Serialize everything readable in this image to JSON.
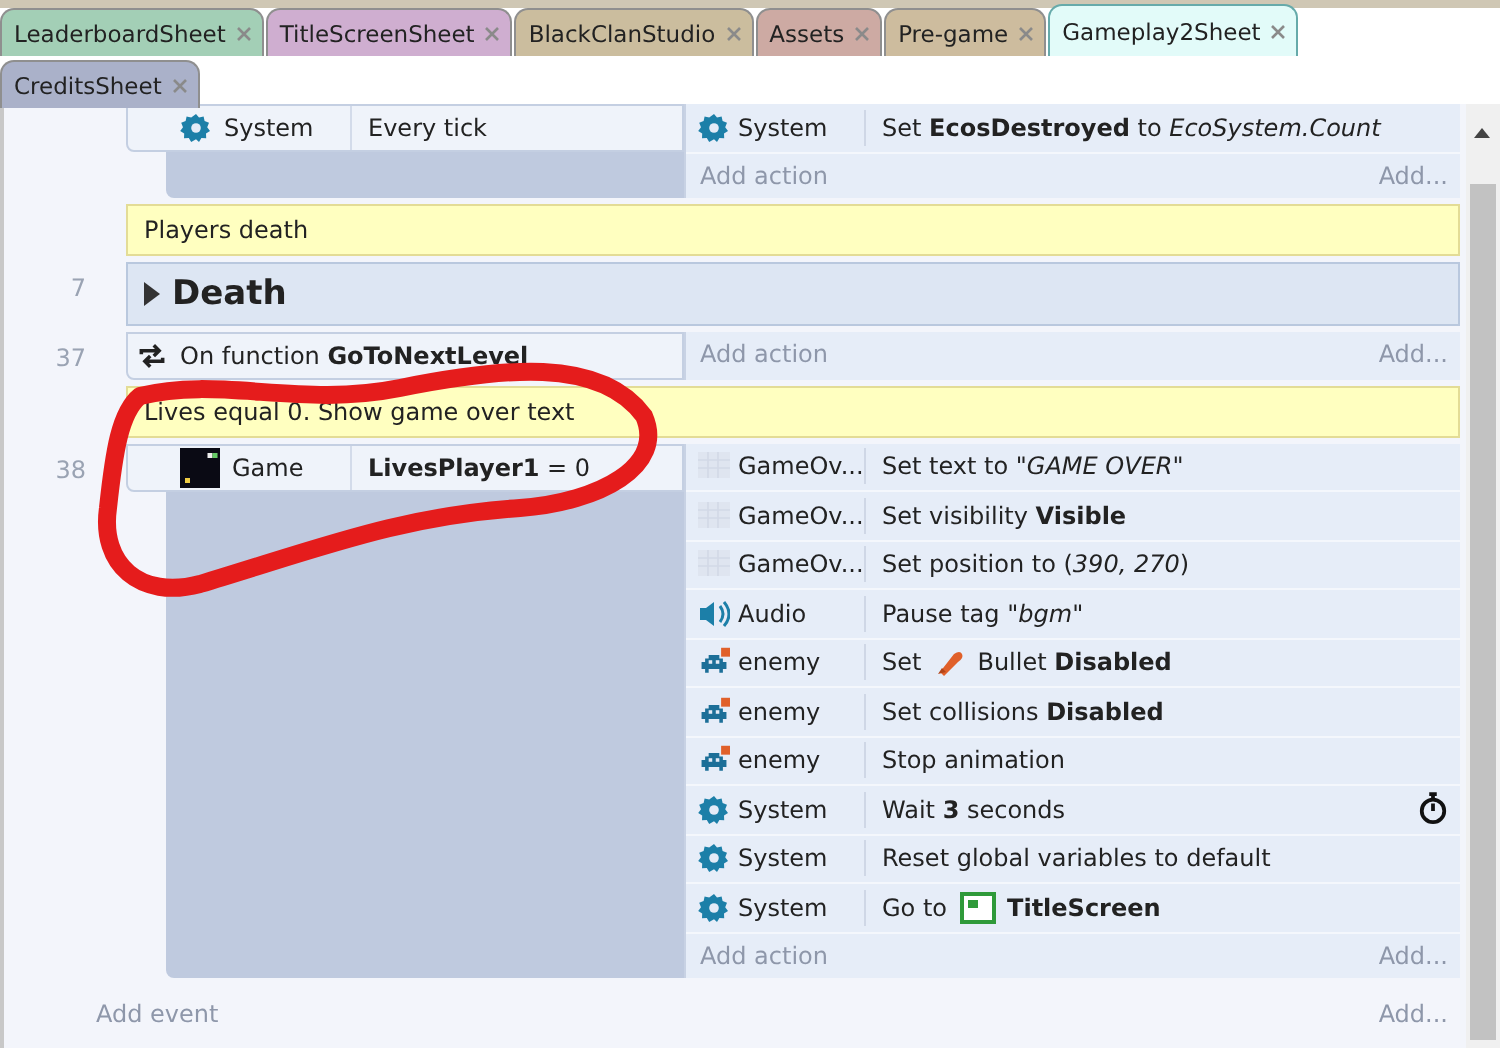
{
  "tabs": [
    {
      "label": "LeaderboardSheet",
      "color": "#a3cfb6",
      "selected": false
    },
    {
      "label": "TitleScreenSheet",
      "color": "#cfaed0",
      "selected": false
    },
    {
      "label": "BlackClanStudio",
      "color": "#cbbd9e",
      "selected": false
    },
    {
      "label": "Assets",
      "color": "#cdaaa3",
      "selected": false
    },
    {
      "label": "Pre-game",
      "color": "#cdbc9e",
      "selected": false
    },
    {
      "label": "Gameplay2Sheet",
      "color": "#e2fbf9",
      "selected": true
    },
    {
      "label": "CreditsSheet",
      "color": "#aab1c9",
      "selected": false
    }
  ],
  "sheet": [
    {
      "kind": "event",
      "conditions": [
        {
          "kind": "system",
          "object": "System",
          "text": "Every tick"
        }
      ],
      "actions": [
        {
          "kind": "system",
          "object": "System",
          "text": "Set **EcosDestroyed** to *EcoSystem.Count*"
        }
      ],
      "add_action": "Add action",
      "add": "Add..."
    },
    {
      "kind": "comment",
      "text": "Players death"
    },
    {
      "kind": "group",
      "line": "7",
      "title": "Death"
    },
    {
      "kind": "event",
      "line": "37",
      "conditions": [
        {
          "kind": "function",
          "text": "On function **GoToNextLevel**"
        }
      ],
      "add_action": "Add action",
      "add": "Add..."
    },
    {
      "kind": "comment",
      "text": "Lives equal 0. Show game over text"
    },
    {
      "kind": "event",
      "line": "38",
      "conditions": [
        {
          "kind": "game",
          "object": "Game",
          "text": "**LivesPlayer1** = 0"
        }
      ],
      "actions": [
        {
          "kind": "text",
          "object": "GameOv...",
          "text": "Set text to \"*GAME OVER*\""
        },
        {
          "kind": "text",
          "object": "GameOv...",
          "text": "Set visibility **Visible**"
        },
        {
          "kind": "text",
          "object": "GameOv...",
          "text": "Set position to (*390, 270*)"
        },
        {
          "kind": "audio",
          "object": "Audio",
          "text": "Pause tag \"*bgm*\""
        },
        {
          "kind": "enemy",
          "object": "enemy",
          "pre": "Set",
          "text": "Bullet **Disabled**"
        },
        {
          "kind": "enemy",
          "object": "enemy",
          "text": "Set collisions **Disabled**"
        },
        {
          "kind": "enemy",
          "object": "enemy",
          "text": "Stop animation"
        },
        {
          "kind": "system",
          "object": "System",
          "text": "Wait **3** seconds",
          "timer": true
        },
        {
          "kind": "system",
          "object": "System",
          "text": "Reset global variables to default"
        },
        {
          "kind": "system",
          "object": "System",
          "pre": "Go to",
          "text": "**TitleScreen**"
        }
      ],
      "add_action": "Add action",
      "add": "Add..."
    }
  ],
  "add_event": "Add event",
  "add_event_more": "Add..."
}
